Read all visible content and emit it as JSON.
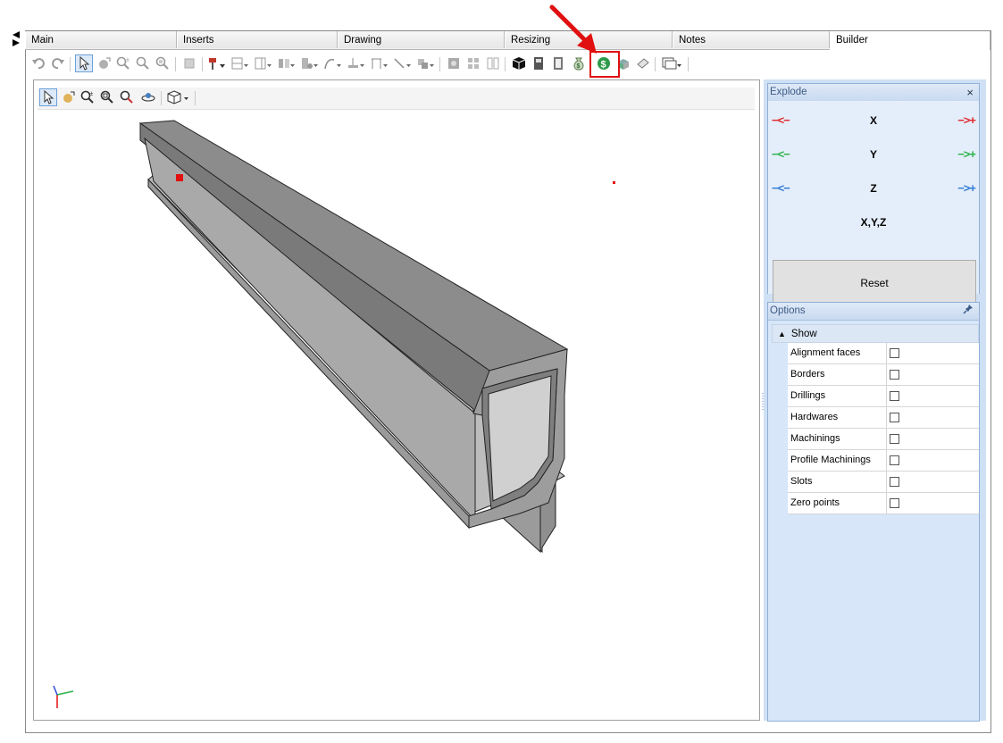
{
  "tabs": [
    {
      "label": "Main",
      "active": false
    },
    {
      "label": "Inserts",
      "active": false
    },
    {
      "label": "Drawing",
      "active": false
    },
    {
      "label": "Resizing",
      "active": false
    },
    {
      "label": "Notes",
      "active": false
    },
    {
      "label": "Builder",
      "active": true
    }
  ],
  "toolbar": {
    "icons": [
      "undo-icon",
      "redo-icon",
      "select-icon",
      "pan-icon",
      "zoom-icon",
      "zoom-window-icon",
      "zoom-extents-icon",
      "copy-icon",
      "drill-icon",
      "panel-icon",
      "door-icon",
      "hardware-icon",
      "profile-icon",
      "curve-icon",
      "measure-icon",
      "dimension-icon",
      "line-icon",
      "align-icon",
      "render-icon",
      "grid-icon",
      "split-icon",
      "cube-solid-icon",
      "cabinet-icon",
      "cabinet-2-icon",
      "money-bag-icon",
      "dollar-icon",
      "materials-icon",
      "edges-icon",
      "window-icon"
    ],
    "highlighted_icon": "money-bag-icon"
  },
  "viewport": {
    "toolbar_icons": [
      "select-icon",
      "pan-icon",
      "zoom-icon",
      "zoom-window-icon",
      "zoom-extents-icon",
      "rotate-icon",
      "view-cube-icon"
    ]
  },
  "explode": {
    "title": "Explode",
    "close_label": "×",
    "axes": [
      {
        "label": "X",
        "color": "#e0282c"
      },
      {
        "label": "Y",
        "color": "#2bb24c"
      },
      {
        "label": "Z",
        "color": "#2f7bd6"
      }
    ],
    "xyz_label": "X,Y,Z",
    "reset_label": "Reset"
  },
  "options": {
    "title": "Options",
    "group_label": "Show",
    "items": [
      {
        "label": "Alignment faces",
        "checked": false
      },
      {
        "label": "Borders",
        "checked": false
      },
      {
        "label": "Drillings",
        "checked": false
      },
      {
        "label": "Hardwares",
        "checked": false
      },
      {
        "label": "Machinings",
        "checked": false
      },
      {
        "label": "Profile Machinings",
        "checked": false
      },
      {
        "label": "Slots",
        "checked": false
      },
      {
        "label": "Zero points",
        "checked": false
      }
    ]
  },
  "colors": {
    "accent_red": "#e01010",
    "panel_blue": "#cfe0f4",
    "profile_gray": "#8c8c8c"
  }
}
